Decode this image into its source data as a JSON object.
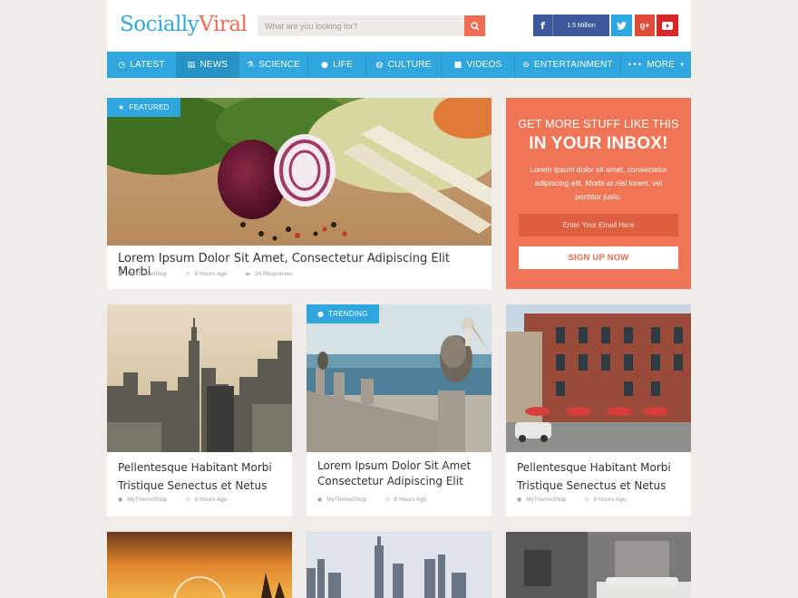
{
  "logo": {
    "part1": "Socially",
    "part2": "Viral"
  },
  "search": {
    "placeholder": "What are you looking for?"
  },
  "social": {
    "facebook_count": "1.5 Million"
  },
  "nav": {
    "items": [
      {
        "label": "LATEST",
        "icon": "clock-icon"
      },
      {
        "label": "NEWS",
        "icon": "document-icon"
      },
      {
        "label": "SCIENCE",
        "icon": "flask-icon"
      },
      {
        "label": "LIFE",
        "icon": "drop-icon"
      },
      {
        "label": "CULTURE",
        "icon": "globe-icon"
      },
      {
        "label": "VIDEOS",
        "icon": "video-camera-icon"
      },
      {
        "label": "ENTERTAINMENT",
        "icon": "gamepad-icon"
      },
      {
        "label": "MORE",
        "icon": "ellipsis-icon"
      }
    ]
  },
  "featured": {
    "badge": "FEATURED",
    "title": "Lorem Ipsum Dolor Sit Amet, Consectetur Adipiscing Elit Morbi",
    "author": "MyThemeShop",
    "time": "8 Hours Ago",
    "responses": "24 Responses"
  },
  "newsletter": {
    "line1": "GET MORE STUFF LIKE THIS",
    "line2": "IN YOUR INBOX!",
    "text": "Lorem ipsum dolor sit amet, consectetur adipiscing elit. Morbi at nisl lorem, vel porttitor justo.",
    "email_placeholder": "Enter Your Email Here",
    "button": "SIGN UP NOW"
  },
  "cards": [
    {
      "title": "Pellentesque Habitant Morbi Tristique Senectus et Netus",
      "author": "MyThemeShop",
      "time": "8 Hours Ago"
    },
    {
      "badge": "TRENDING",
      "title": "Lorem Ipsum Dolor Sit Amet Consectetur Adipiscing Elit",
      "author": "MyThemeShop",
      "time": "8 Hours Ago"
    },
    {
      "title": "Pellentesque Habitant Morbi Tristique Senectus et Netus",
      "author": "MyThemeShop",
      "time": "8 Hours Ago"
    }
  ],
  "colors": {
    "accent_blue": "#2fa6dd",
    "accent_orange": "#f06c52",
    "background": "#efecea"
  }
}
